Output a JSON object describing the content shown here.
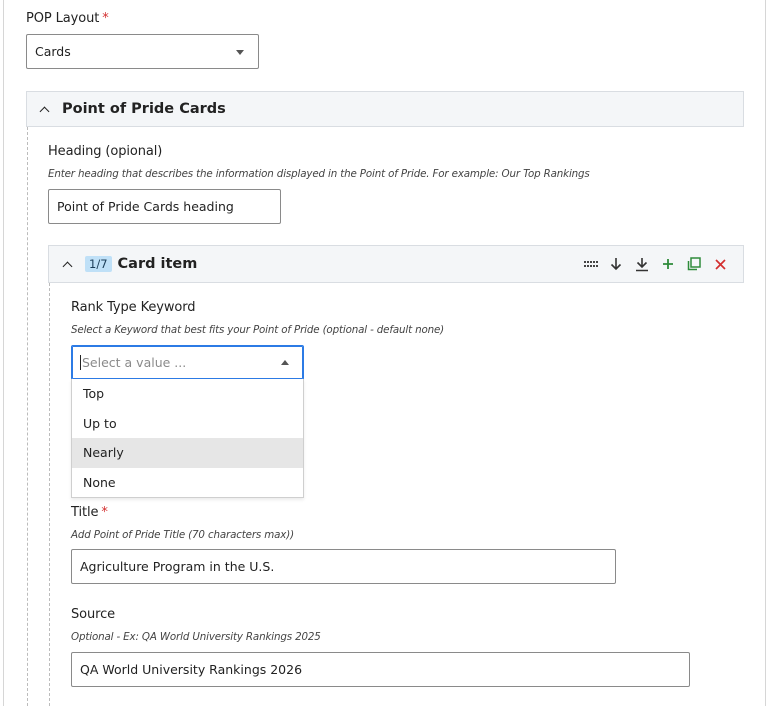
{
  "pop_layout": {
    "label": "POP Layout",
    "required_mark": "*",
    "value": "Cards"
  },
  "pop_cards_section": {
    "title": "Point of Pride Cards",
    "heading": {
      "label": "Heading (opional)",
      "hint": "Enter heading that describes the information displayed in the Point of Pride. For example: Our Top Rankings",
      "value": "Point of Pride Cards heading"
    },
    "card_item": {
      "counter": "1/7",
      "title": "Card item",
      "toolbar": {
        "drag_icon": "drag-handle-icon",
        "move_down_icon": "arrow-down-icon",
        "move_bottom_icon": "arrow-to-bottom-icon",
        "add_icon": "plus-icon",
        "duplicate_icon": "duplicate-icon",
        "remove_icon": "close-icon"
      },
      "rank_type": {
        "label": "Rank Type Keyword",
        "hint": "Select a Keyword that best fits your Point of Pride (optional - default none)",
        "placeholder": "Select a value ...",
        "options": [
          "Top",
          "Up to",
          "Nearly",
          "None"
        ],
        "highlighted_option": "Nearly"
      },
      "title_field": {
        "label": "Title",
        "required_mark": "*",
        "hint": "Add Point of Pride Title (70 characters max))",
        "value": "Agriculture Program in the U.S."
      },
      "source_field": {
        "label": "Source",
        "hint": "Optional - Ex: QA World University Rankings 2025",
        "value": "QA World University Rankings 2026"
      }
    }
  },
  "colors": {
    "accent_green": "#2e8b3a",
    "remove_red": "#d32f2f",
    "badge_blue": "#bfe0f7",
    "focus_blue": "#2c7be5"
  }
}
